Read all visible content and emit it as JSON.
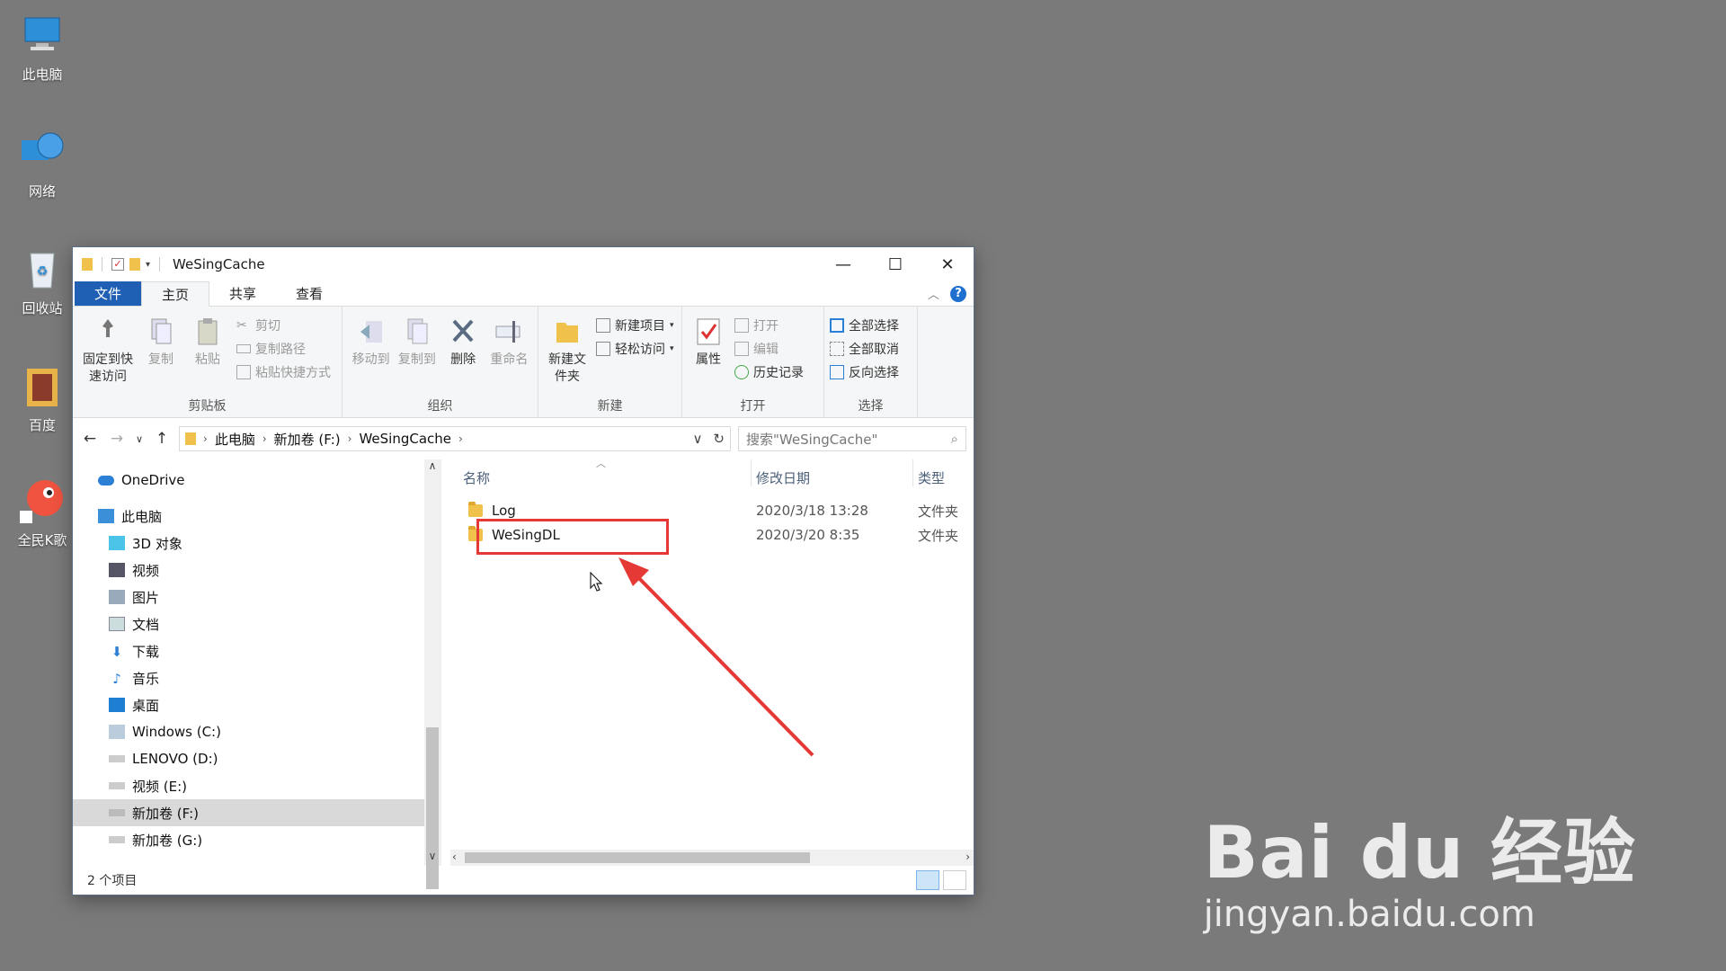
{
  "desktop": {
    "icons": [
      {
        "label": "此电脑",
        "icon": "computer-icon"
      },
      {
        "label": "网络",
        "icon": "network-icon"
      },
      {
        "label": "回收站",
        "icon": "recycle-bin-icon"
      },
      {
        "label": "百度",
        "icon": "baidu-folder-icon"
      },
      {
        "label": "全民K歌",
        "icon": "kge-app-icon"
      }
    ]
  },
  "window": {
    "title": "WeSingCache",
    "controls": {
      "minimize": "—",
      "maximize": "☐",
      "close": "✕"
    }
  },
  "ribbon_tabs": [
    "文件",
    "主页",
    "共享",
    "查看"
  ],
  "ribbon": {
    "clipboard": {
      "label": "剪贴板",
      "pin": "固定到快速访问",
      "copy": "复制",
      "paste": "粘贴",
      "cut": "剪切",
      "copy_path": "复制路径",
      "paste_shortcut": "粘贴快捷方式"
    },
    "organize": {
      "label": "组织",
      "move_to": "移动到",
      "copy_to": "复制到",
      "delete": "删除",
      "rename": "重命名"
    },
    "new": {
      "label": "新建",
      "new_folder": "新建文件夹",
      "new_item": "新建项目",
      "easy_access": "轻松访问"
    },
    "open": {
      "label": "打开",
      "properties": "属性",
      "open": "打开",
      "edit": "编辑",
      "history": "历史记录"
    },
    "select": {
      "label": "选择",
      "select_all": "全部选择",
      "select_none": "全部取消",
      "invert": "反向选择"
    }
  },
  "address": {
    "crumbs": [
      "此电脑",
      "新加卷 (F:)",
      "WeSingCache"
    ],
    "search_placeholder": "搜索\"WeSingCache\""
  },
  "nav_pane": {
    "items": [
      {
        "label": "OneDrive",
        "icon": "onedrive-icon"
      },
      {
        "label": "此电脑",
        "icon": "computer-icon"
      },
      {
        "label": "3D 对象",
        "icon": "3d-objects-icon"
      },
      {
        "label": "视频",
        "icon": "videos-icon"
      },
      {
        "label": "图片",
        "icon": "pictures-icon"
      },
      {
        "label": "文档",
        "icon": "documents-icon"
      },
      {
        "label": "下载",
        "icon": "downloads-icon"
      },
      {
        "label": "音乐",
        "icon": "music-icon"
      },
      {
        "label": "桌面",
        "icon": "desktop-icon"
      },
      {
        "label": "Windows (C:)",
        "icon": "drive-icon"
      },
      {
        "label": "LENOVO (D:)",
        "icon": "drive-icon"
      },
      {
        "label": "视频 (E:)",
        "icon": "drive-icon"
      },
      {
        "label": "新加卷 (F:)",
        "icon": "drive-icon"
      },
      {
        "label": "新加卷 (G:)",
        "icon": "drive-icon"
      }
    ],
    "selected": "新加卷 (F:)"
  },
  "file_list": {
    "columns": {
      "name": "名称",
      "date": "修改日期",
      "type": "类型"
    },
    "rows": [
      {
        "name": "Log",
        "date": "2020/3/18 13:28",
        "type": "文件夹"
      },
      {
        "name": "WeSingDL",
        "date": "2020/3/20 8:35",
        "type": "文件夹"
      }
    ]
  },
  "status": {
    "count": "2 个项目"
  },
  "watermark": {
    "line1": "Bai du 经验",
    "line2": "jingyan.baidu.com"
  },
  "colors": {
    "accent": "#1f5fb4",
    "highlight": "#e53935",
    "desktop": "#7a7a7a"
  }
}
